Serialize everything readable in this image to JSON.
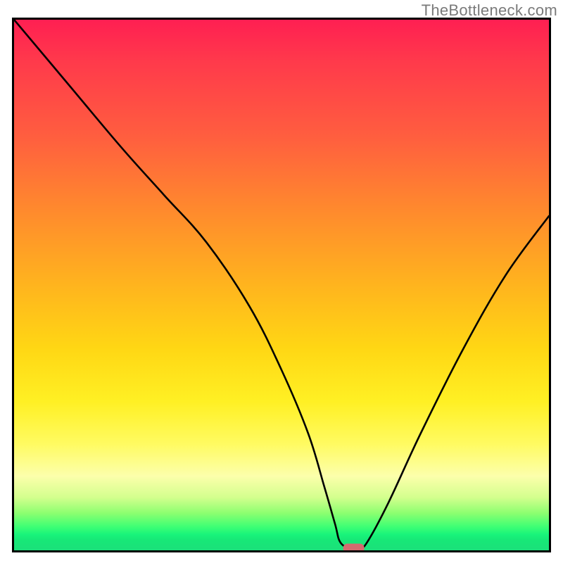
{
  "watermark": "TheBottleneck.com",
  "chart_data": {
    "type": "line",
    "title": "",
    "xlabel": "",
    "ylabel": "",
    "xlim": [
      0,
      100
    ],
    "ylim": [
      0,
      100
    ],
    "series": [
      {
        "name": "bottleneck-curve",
        "x": [
          0,
          10,
          20,
          28,
          36,
          44,
          50,
          55,
          58,
          60,
          61,
          63,
          64.5,
          66,
          70,
          76,
          84,
          92,
          100
        ],
        "y": [
          100,
          88,
          76,
          67,
          58,
          46,
          34,
          22,
          12,
          5,
          1.5,
          0.3,
          0.3,
          1.5,
          9,
          22,
          38,
          52,
          63
        ]
      }
    ],
    "marker": {
      "x": 63.5,
      "y": 0.4,
      "color": "#d46a6f"
    },
    "background_gradient": {
      "orientation": "vertical",
      "stops": [
        {
          "pos": 0.0,
          "color": "#ff1f52"
        },
        {
          "pos": 0.5,
          "color": "#ffb41e"
        },
        {
          "pos": 0.8,
          "color": "#fffb62"
        },
        {
          "pos": 0.93,
          "color": "#8cff70"
        },
        {
          "pos": 1.0,
          "color": "#1be07a"
        }
      ]
    }
  }
}
